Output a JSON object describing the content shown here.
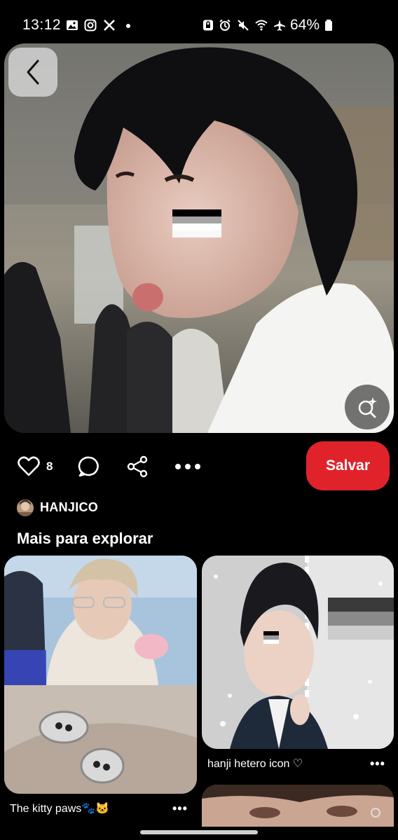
{
  "status_bar": {
    "time": "13:12",
    "battery": "64%",
    "left_icons": [
      "gallery-icon",
      "instagram-icon",
      "x-icon",
      "dot-icon"
    ],
    "right_icons": [
      "profile-lock-icon",
      "alarm-icon",
      "mute-icon",
      "wifi-icon",
      "airplane-icon",
      "battery-icon"
    ]
  },
  "pin": {
    "like_count": "8",
    "save_label": "Salvar",
    "author": "HANJICO"
  },
  "explore": {
    "title": "Mais para explorar",
    "items": [
      {
        "caption": "The kitty paws🐾🐱",
        "more": "•••"
      },
      {
        "caption": "hanji hetero icon ♡",
        "more": "•••"
      }
    ]
  },
  "colors": {
    "accent": "#e0232b",
    "background": "#000000"
  }
}
